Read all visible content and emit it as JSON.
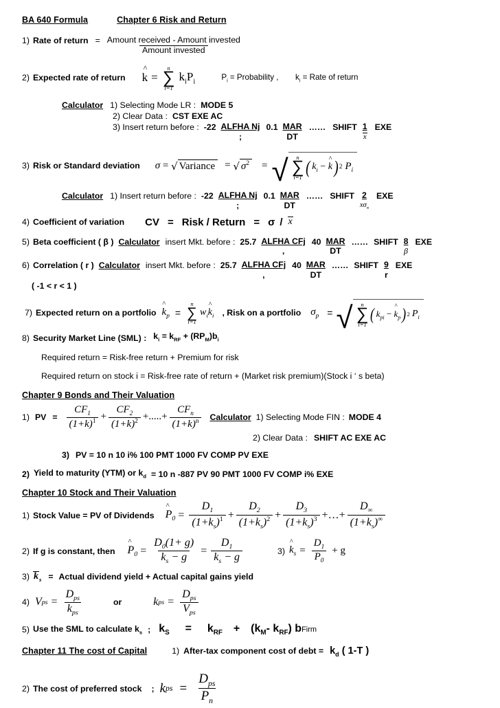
{
  "document": {
    "title": "BA 640 Formula",
    "header_chapter": "Chapter 6 Risk and Return"
  },
  "sections": {
    "ch6": {
      "item1": {
        "number": "1)",
        "label": "Rate of  return",
        "equals": "=",
        "numerator": "Amount received  - Amount invested",
        "denominator": "Amount invested"
      },
      "item2": {
        "number": "2)",
        "label": "Expected rate of return",
        "formula": {
          "lhs": "k",
          "eq": "=",
          "sum_top": "n",
          "sum_bottom": "i=1",
          "term_k": "k",
          "term_k_sub": "i",
          "term_p": "P",
          "term_p_sub": "i"
        },
        "legend_1": "P",
        "legend_1_sub": "i",
        "legend_1_text": "= Probability ,",
        "legend_2": "k",
        "legend_2_sub": "i",
        "legend_2_text": "= Rate of return"
      },
      "calc1": {
        "label": "Calculator",
        "line1": "1) Selecting Mode LR  :",
        "line1_keys": "MODE   5",
        "line2": "2) Clear Data  :",
        "line2_keys": "CST   EXE   AC",
        "line3": "3) Insert return before  :",
        "line3_v1": "-22",
        "line3_k1": "ALFHA   Nj",
        "line3_k1_sub": ";",
        "line3_v2": "0.1",
        "line3_k2": "MAR",
        "line3_k2_sub": "DT",
        "line3_dots": "……",
        "line3_shift": "SHIFT",
        "line3_num": "1",
        "line3_num_sub": "x",
        "line3_exe": "EXE"
      },
      "item3": {
        "number": "3)",
        "label": "Risk or Standard deviation",
        "f1_sigma": "σ",
        "f1_eq": "=",
        "f1_rad": "Variance",
        "f2_eq": "=",
        "f2_rad": "σ",
        "f2_rad_sup": "2",
        "f3_eq": "=",
        "sum_top": "n",
        "sum_bottom": "i=1",
        "term_k": "k",
        "term_k_sub": "i",
        "term_minus": "−",
        "term_khat": "k",
        "term_pow": "2",
        "term_p": "P",
        "term_p_sub": "i"
      },
      "calc2": {
        "label": "Calculator",
        "line1": "1) Insert return before  :",
        "v1": "-22",
        "k1": "ALFHA   Nj",
        "k1_sub": ";",
        "v2": "0.1",
        "k2": "MAR",
        "k2_sub": "DT",
        "dots": "……",
        "shift": "SHIFT",
        "num": "2",
        "num_sub": "xσ",
        "num_sub_n": "n",
        "exe": "EXE"
      },
      "item4": {
        "number": "4)",
        "label": "Coefficient of variation",
        "cv": "CV",
        "eq1": "=",
        "rr": "Risk / Return",
        "eq2": "=",
        "sigma": "σ",
        "slash": "/",
        "xbar": "x"
      },
      "item5": {
        "number": "5)",
        "label": "Beta coefficient  ( β )",
        "calc_label": "Calculator",
        "insert": "insert  Mkt. before :",
        "v1": "25.7",
        "k1": "ALFHA   CFj",
        "k1_sub": ",",
        "v2": "40",
        "k2": "MAR",
        "k2_sub": "DT",
        "dots": "……",
        "shift": "SHIFT",
        "num": "8",
        "num_sub": "β",
        "exe": "EXE"
      },
      "item6": {
        "number": "6)",
        "label": "Correlation ( r )",
        "calc_label": "Calculator",
        "insert": "insert  Mkt. before :",
        "v1": "25.7",
        "k1": "ALFHA   CFj",
        "k1_sub": ",",
        "v2": "40",
        "k2": "MAR",
        "k2_sub": "DT",
        "dots": "……",
        "shift": "SHIFT",
        "num": "9",
        "num_sub": "r",
        "exe": "EXE",
        "range": "( -1 < r < 1 )"
      },
      "item7": {
        "number": "7)",
        "label": "Expected return on a portfolio",
        "khat_p": "k",
        "khat_p_sub": "p",
        "eq": "=",
        "sum_top": "n",
        "sum_bottom": "i=1",
        "w": "w",
        "w_sub": "i",
        "k": "k",
        "k_sub": "i",
        "label2": ", Risk on a portfolio",
        "sigma_p": "σ",
        "sigma_p_sub": "p",
        "eq2": "=",
        "sum2_top": "n",
        "sum2_bottom": "i=1",
        "kpi": "k",
        "kpi_sub": "pi",
        "minus": "−",
        "khp": "k",
        "khp_sub": "p",
        "pow": "2",
        "P": "P",
        "P_sub": "i"
      },
      "item8": {
        "number": "8)",
        "label": "Security Market Line (SML) :",
        "formula_k": "k",
        "formula_k_sub": "i",
        "eq": "=",
        "krf": "k",
        "krf_sub": "RF",
        "plus": "+",
        "rpm": "(RP",
        "rpm_sub": "M",
        "rpm_end": ")b",
        "rpm_end_sub": "i"
      },
      "note1": "Required return  =  Risk-free return  +  Premium for risk",
      "note2": "Required return on stock i  =  Risk-free rate of return + (Market risk premium)(Stock i ‘ s beta)"
    },
    "ch9": {
      "heading": "Chapter 9  Bonds and Their Valuation",
      "item1": {
        "number": "1)",
        "label": "PV",
        "eq": "=",
        "n1": "CF",
        "n1_sub": "1",
        "d1": "(1+k)",
        "d1_sup": "1",
        "plus1": "+",
        "n2": "CF",
        "n2_sub": "2",
        "d2": "(1+k)",
        "d2_sup": "2",
        "plus2": "+.....+",
        "n3": "CF",
        "n3_sub": "n",
        "d3": "(1+k)",
        "d3_sup": "n",
        "calc_label": "Calculator",
        "calc_line1": "1) Selecting Mode FIN  :",
        "calc_line1_keys": "MODE   4",
        "calc_line2": "2) Clear Data  :",
        "calc_line2_keys": "SHIFT   AC   EXE   AC",
        "calc_line3_num": "3)",
        "calc_line3": "PV  =  10  n  10  i%  100  PMT  1000  FV  COMP  PV  EXE"
      },
      "item2": {
        "number": "2)",
        "label": "Yield to maturity (YTM) or k",
        "label_sub": "d",
        "formula": "=  10   n   -887   PV   90   PMT   1000   FV   COMP   i%   EXE"
      }
    },
    "ch10": {
      "heading": "Chapter 10 Stock and Their Valuation",
      "item1": {
        "number": "1)",
        "label": "Stock Value   =   PV of  Dividends",
        "lhs": "P",
        "lhs_sub": "0",
        "eq": "=",
        "n1": "D",
        "n1_sub": "1",
        "d1": "(1+k",
        "d1_sub": "s",
        "d1_close": ")",
        "d1_sup": "1",
        "plus1": "+",
        "n2": "D",
        "n2_sub": "2",
        "d2_sup": "2",
        "plus2": "+",
        "n3": "D",
        "n3_sub": "3",
        "d3_sup": "3",
        "plus3": "+…+",
        "n4": "D",
        "n4_sub": "∞",
        "d4_sup": "∞"
      },
      "item2": {
        "number": "2)",
        "label": "If  g  is constant, then",
        "lhs": "P",
        "lhs_sub": "0",
        "eq": "=",
        "num1": "D",
        "num1_sub": "0",
        "num1_paren": "(1+ g)",
        "den1": "k",
        "den1_sub": "s",
        "den1_rest": "− g",
        "eq2": "=",
        "num2": "D",
        "num2_sub": "1",
        "den2": "k",
        "den2_sub": "s",
        "den2_rest": "− g"
      },
      "item3_right": {
        "number": "3)",
        "khat": "k",
        "khat_sub": "s",
        "eq": "=",
        "num": "D",
        "num_sub": "1",
        "den": "P",
        "den_sub": "0",
        "plus": "+  g"
      },
      "item3": {
        "number": "3)",
        "kbar": "k",
        "kbar_sub": "s",
        "eq": "=",
        "text": "Actual dividend yield + Actual capital gains yield"
      },
      "item4": {
        "number": "4)",
        "v": "V",
        "v_sub": "ps",
        "eq": "=",
        "num": "D",
        "num_sub": "ps",
        "den": "k",
        "den_sub": "ps",
        "or": "or",
        "k2": "k",
        "k2_sub": "ps",
        "eq2": "=",
        "num2": "D",
        "num2_sub": "ps",
        "den2": "V",
        "den2_sub": "ps"
      },
      "item5": {
        "number": "5)",
        "label": "Use the SML to calculate k",
        "label_sub": "s",
        "semicolon": ";",
        "ks": "k",
        "ks_sub": "S",
        "eq": "=",
        "krf": "k",
        "krf_sub": "RF",
        "plus": "+",
        "km_open": "(k",
        "km_sub": "M",
        "minus": "- k",
        "krf2_sub": "RF",
        "close": ") b",
        "firm": "Firm"
      }
    },
    "ch11": {
      "heading": "Chapter 11 The cost of Capital",
      "item1": {
        "number": "1)",
        "label": "After-tax component cost of debt  =",
        "kd": "k",
        "kd_sub": "d",
        "rest": "( 1-T )"
      },
      "item2": {
        "number": "2)",
        "label": "The cost of preferred stock",
        "semicolon": ";",
        "k": "k",
        "k_sub": "ps",
        "eq": "=",
        "num": "D",
        "num_sub": "ps",
        "den": "P",
        "den_sub": "n"
      }
    }
  }
}
